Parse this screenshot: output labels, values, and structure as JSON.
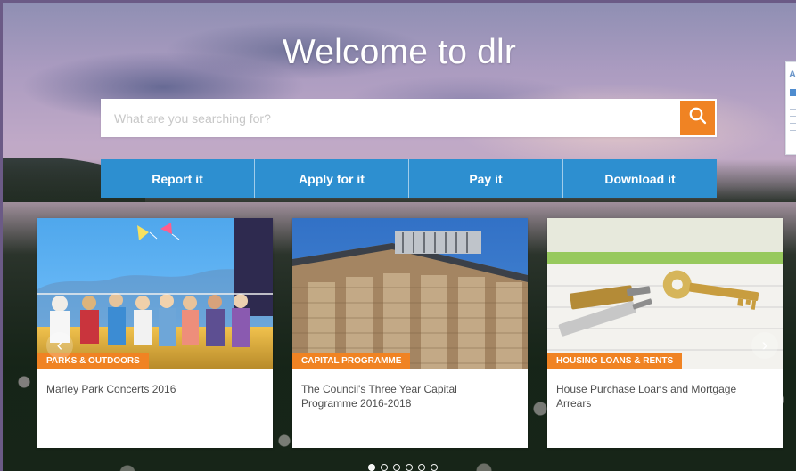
{
  "hero": {
    "title": "Welcome to dlr"
  },
  "search": {
    "placeholder": "What are you searching for?",
    "button_icon": "search-icon"
  },
  "quick_actions": [
    {
      "label": "Report it"
    },
    {
      "label": "Apply for it"
    },
    {
      "label": "Pay it"
    },
    {
      "label": "Download it"
    }
  ],
  "cards": [
    {
      "tag": "PARKS & OUTDOORS",
      "title": "Marley Park Concerts 2016"
    },
    {
      "tag": "CAPITAL PROGRAMME",
      "title": "The Council's Three Year Capital Programme 2016-2018"
    },
    {
      "tag": "HOUSING LOANS & RENTS",
      "title": "House Purchase Loans and Mortgage Arrears"
    }
  ],
  "carousel": {
    "left_arrow_icon": "chevron-left-icon",
    "right_arrow_icon": "chevron-right-icon",
    "active_slide": 1,
    "slides_total": 6
  },
  "side_widget": {
    "letter": "A"
  },
  "colors": {
    "accent_orange": "#f08323",
    "action_blue": "#2d8fd0",
    "widget_blue": "#4e8ccf"
  }
}
